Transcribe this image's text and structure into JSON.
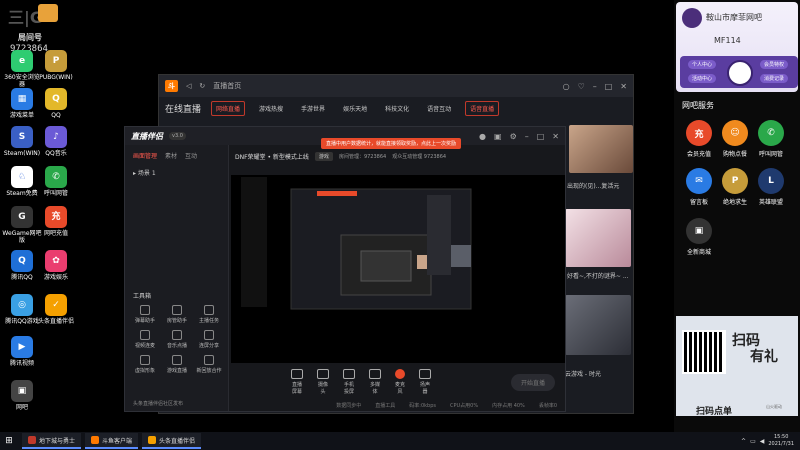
{
  "desktop": {
    "overlay_name": "局间号",
    "overlay_number": "9723864",
    "icons": [
      {
        "label": "360安全浏览器",
        "color": "#2ecc71",
        "glyph": "e"
      },
      {
        "label": "PUBG(WIN)",
        "color": "#c69c3a",
        "glyph": "P"
      },
      {
        "label": "游戏菜单",
        "color": "#2a7be4",
        "glyph": "▦"
      },
      {
        "label": "QQ",
        "color": "#e3b82a",
        "glyph": "Q"
      },
      {
        "label": "Steam(WIN)",
        "color": "#3a5fc4",
        "glyph": "S"
      },
      {
        "label": "QQ音乐",
        "color": "#6b5ad6",
        "glyph": "♪"
      },
      {
        "label": "Steam免费",
        "color": "#fff",
        "glyph": "♘"
      },
      {
        "label": "呼叫网管",
        "color": "#2aa84a",
        "glyph": "✆"
      },
      {
        "label": "WeGame网吧版",
        "color": "#333",
        "glyph": "G"
      },
      {
        "label": "网吧充值",
        "color": "#e84a2a",
        "glyph": "充"
      },
      {
        "label": "腾讯QQ",
        "color": "#1f6fd6",
        "glyph": "Q"
      },
      {
        "label": "游戏娱乐",
        "color": "#ea3d6f",
        "glyph": "✿"
      },
      {
        "label": "腾讯QQ游戏",
        "color": "#3aa0e4",
        "glyph": "◎"
      },
      {
        "label": "头条直播伴侣",
        "color": "#f5a000",
        "glyph": "✓"
      },
      {
        "label": "腾讯视频",
        "color": "#2a7be4",
        "glyph": "▶"
      },
      {
        "label": "网吧",
        "color": "#444",
        "glyph": "▣"
      }
    ]
  },
  "stream_window": {
    "title_tab": "直播首页",
    "nav_big": "在线直播",
    "nav_items": [
      "网络直播",
      "游戏热搜",
      "手游世界",
      "娱乐天地",
      "科技文化",
      "语音互动",
      "语音直播"
    ],
    "caption1": "出现的(见)...复活元",
    "caption2": "英雄100Exp 网络直播",
    "caption3": "好看~,不打的谜界~ ...",
    "caption4": "云游戏 - 时光"
  },
  "companion": {
    "title": "直播伴侣",
    "version": "v3.0",
    "notice": "直播中用户数据统计，就能直接领取奖励，点此上一次奖励",
    "side_tabs": [
      "画面管理",
      "素材",
      "互动"
    ],
    "scene": "场景 1",
    "tools_header": "工具箱",
    "tools": [
      "弹幕助手",
      "房管助手",
      "主播任务",
      "视频连麦",
      "音乐点播",
      "连屏分享",
      "虚拟形象",
      "游戏直播",
      "新回放合作"
    ],
    "side_footer": "头条直播伴侣社区发布",
    "game_title": "DNF荣耀堂 • 新型模式上线",
    "game_tag": "游戏",
    "room_label": "房间管理：9723864",
    "sub_info": "观众互动管理 9723864",
    "controls": [
      "直播屏幕",
      "摄像头",
      "手机投屏",
      "多媒体",
      "麦克风",
      "扬声器"
    ],
    "start_label": "开始直播",
    "status": [
      "数据同步中",
      "直播工具",
      "码率:0kbps",
      "CPU占用0%",
      "内存占用 40%",
      "丢帧率0"
    ]
  },
  "cafe": {
    "name": "鞍山市摩菲网吧",
    "code": "MF114",
    "btn_user": "个人中心",
    "btn_act": "活动中心",
    "btn_vip": "会员特权",
    "btn_order": "消费记录",
    "services_title": "网吧服务",
    "services": [
      {
        "label": "会员充值",
        "color": "#e84a2a",
        "glyph": "充"
      },
      {
        "label": "购物点餐",
        "color": "#f08a1e",
        "glyph": "☺"
      },
      {
        "label": "呼叫网管",
        "color": "#2aa84a",
        "glyph": "✆"
      },
      {
        "label": "留言板",
        "color": "#2a7be4",
        "glyph": "✉"
      },
      {
        "label": "绝地求生",
        "color": "#c69c3a",
        "glyph": "P"
      },
      {
        "label": "英雄联盟",
        "color": "#1f3a6e",
        "glyph": "L"
      },
      {
        "label": "全新商城",
        "color": "#333",
        "glyph": "▣"
      }
    ],
    "promo_line1": "扫码",
    "promo_line2": "有礼",
    "promo_bottom": "扫码点单",
    "promo_small": "山火驱动"
  },
  "taskbar": {
    "start": "⊞",
    "tasks": [
      "地下城与勇士",
      "斗鱼客户端",
      "头条直播伴侣"
    ],
    "time": "15:50",
    "date": "2021/7/31"
  }
}
